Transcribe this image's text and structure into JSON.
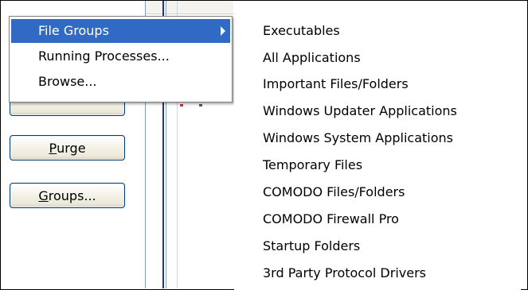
{
  "left_buttons": {
    "hidden_label_underlined": "",
    "purge": {
      "mnemonic": "P",
      "rest": "urge"
    },
    "groups": {
      "mnemonic": "G",
      "rest": "roups..."
    }
  },
  "menu": {
    "items": [
      {
        "label": "File Groups",
        "has_submenu": true,
        "selected": true
      },
      {
        "label": "Running Processes...",
        "has_submenu": false,
        "selected": false
      },
      {
        "label": "Browse...",
        "has_submenu": false,
        "selected": false
      }
    ]
  },
  "submenu": {
    "items": [
      "Executables",
      "All Applications",
      "Important Files/Folders",
      "Windows Updater Applications",
      "Windows System Applications",
      "Temporary Files",
      "COMODO Files/Folders",
      "COMODO Firewall Pro",
      "Startup Folders",
      "3rd Party Protocol Drivers"
    ]
  },
  "colors": {
    "menu_highlight": "#316ac5",
    "button_border": "#003c74"
  }
}
